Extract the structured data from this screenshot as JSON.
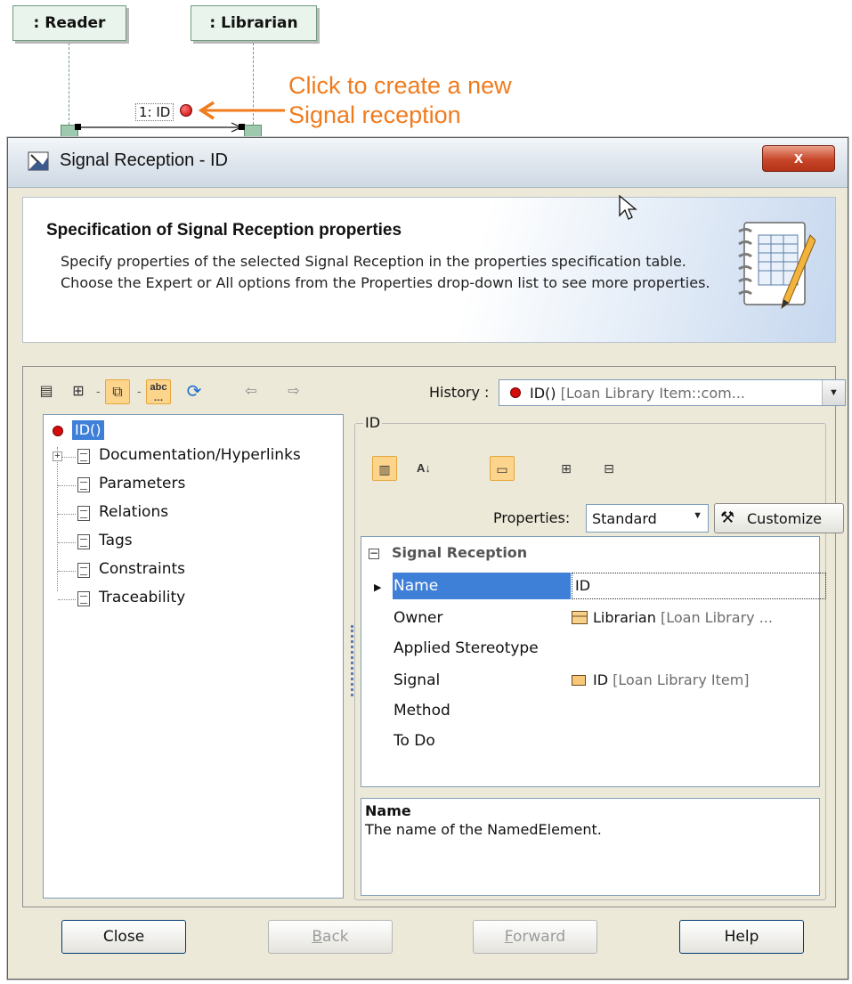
{
  "diagram": {
    "lifelines": [
      ": Reader",
      ": Librarian"
    ],
    "message_label": "1: ID",
    "callout_line1": "Click to create a new",
    "callout_line2": "Signal reception"
  },
  "window": {
    "title": "Signal Reception - ID",
    "close_glyph": "x"
  },
  "header": {
    "title": "Specification of Signal Reception properties",
    "description": "Specify properties of the selected Signal Reception in the properties specification table. Choose the Expert or All options from the Properties drop-down list to see more properties."
  },
  "toolbar": {
    "history_label": "History :",
    "history_value": "ID()",
    "history_context": "[Loan Library Item::com..."
  },
  "tree": {
    "root": "ID()",
    "items": [
      "Documentation/Hyperlinks",
      "Parameters",
      "Relations",
      "Tags",
      "Constraints",
      "Traceability"
    ]
  },
  "panel": {
    "group_title": "ID",
    "properties_label": "Properties:",
    "properties_value": "Standard",
    "customize_label": "Customize",
    "category": "Signal Reception",
    "rows": [
      {
        "name": "Name",
        "value": "ID",
        "context": ""
      },
      {
        "name": "Owner",
        "value": "Librarian",
        "context": "[Loan Library ..."
      },
      {
        "name": "Applied Stereotype",
        "value": "",
        "context": ""
      },
      {
        "name": "Signal",
        "value": "ID",
        "context": "[Loan Library Item]"
      },
      {
        "name": "Method",
        "value": "",
        "context": ""
      },
      {
        "name": "To Do",
        "value": "",
        "context": ""
      }
    ],
    "desc_title": "Name",
    "desc_text": "The name of the NamedElement."
  },
  "buttons": {
    "close": "Close",
    "back_prefix": "",
    "back_key": "B",
    "back_rest": "ack",
    "forward_key": "F",
    "forward_rest": "orward",
    "help": "Help"
  }
}
